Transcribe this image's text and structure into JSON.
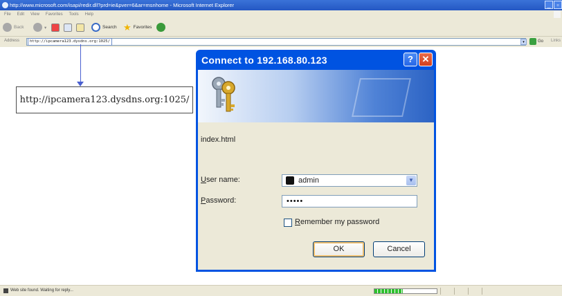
{
  "window": {
    "title": "http://www.microsoft.com/isapi/redir.dll?prd=ie&pver=6&ar=msnhome - Microsoft Internet Explorer"
  },
  "menu": [
    "File",
    "Edit",
    "View",
    "Favorites",
    "Tools",
    "Help"
  ],
  "toolbar": {
    "back_label": "Back",
    "search_label": "Search",
    "favorites_label": "Favorites"
  },
  "address_bar": {
    "label": "Address",
    "value": "http://ipcamera123.dysdns.org:1025/",
    "go_label": "Go",
    "links_label": "Links"
  },
  "callout": {
    "text": "http://ipcamera123.dysdns.org:1025/"
  },
  "dialog": {
    "title": "Connect to 192.168.80.123",
    "host": "index.html",
    "username_label": "User name:",
    "username_value": "admin",
    "password_label": "Password:",
    "password_value": "•••••",
    "remember_label": "Remember my password",
    "remember_checked": false,
    "ok_label": "OK",
    "cancel_label": "Cancel"
  },
  "status_bar": {
    "text": "Web site found. Waiting for reply...",
    "progress": 0.45
  },
  "colors": {
    "titlebar_blue": "#2457c3",
    "dialog_border": "#0053e1",
    "dialog_face": "#ece9d8",
    "progress_green": "#2ec02e"
  },
  "icons": [
    "window-icon",
    "back-arrow-icon",
    "forward-arrow-icon",
    "stop-icon",
    "refresh-icon",
    "home-icon",
    "search-icon",
    "favorites-star-icon",
    "media-icon",
    "go-arrow-icon",
    "keys-icon",
    "help-icon",
    "close-icon",
    "user-avatar-icon",
    "hourglass-icon"
  ]
}
